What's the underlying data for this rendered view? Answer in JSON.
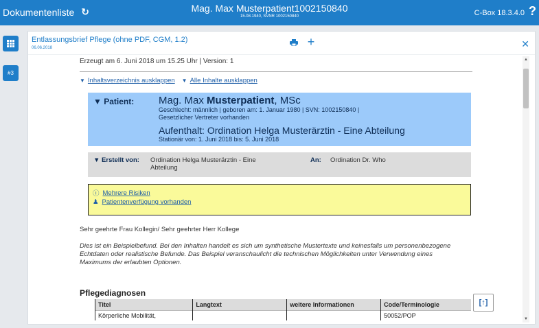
{
  "topbar": {
    "title": "Dokumentenliste",
    "refresh_icon": "refresh-icon",
    "patient_name": "Mag. Max Musterpatient1002150840",
    "patient_sub": "15.08.1940, SVNR 1002150840",
    "version": "C-Box 18.3.4.0",
    "help": "?"
  },
  "sidebar": {
    "grid_icon": "grid-icon",
    "badge": "#3"
  },
  "document": {
    "title": "Entlassungsbrief Pflege (ohne PDF, CGM, 1.2)",
    "date": "06.06.2018",
    "meta": "Erzeugt am 6. Juni 2018 um 15.25 Uhr | Version: 1",
    "toggle_toc": "Inhaltsverzeichnis ausklappen",
    "toggle_all": "Alle Inhalte ausklappen"
  },
  "patient": {
    "label": "Patient:",
    "name_prefix": "Mag. Max ",
    "name_bold": "Musterpatient",
    "name_suffix": ", MSc",
    "line1": "Geschlecht: männlich | geboren am: 1. Januar 1980 | SVN: 1002150840 |",
    "line2": "Gesetzlicher Vertreter vorhanden",
    "stay": "Aufenthalt:  Ordination Helga Musterärztin - Eine Abteilung",
    "stay_dates": "Stationär von: 1. Juni 2018 bis: 5. Juni 2018"
  },
  "creator": {
    "label": "Erstellt von:",
    "text": "Ordination Helga Musterärztin - Eine Abteilung",
    "an_label": "An:",
    "an_text": "Ordination Dr. Who"
  },
  "warnings": {
    "risk": "Mehrere Risiken",
    "directive": "Patientenverfügung vorhanden"
  },
  "body": {
    "greeting": "Sehr geehrte Frau Kollegin/ Sehr geehrter Herr Kollege",
    "intro": "Dies ist ein Beispielbefund. Bei den Inhalten handelt es sich um synthetische Mustertexte und keinesfalls um personenbezogene Echtdaten oder realistische Befunde. Das Beispiel veranschaulicht die technischen Möglichkeiten unter Verwendung eines Maximums der erlaubten Optionen."
  },
  "section": {
    "title": "Pflegediagnosen",
    "columns": [
      "Titel",
      "Langtext",
      "weitere Informationen",
      "Code/Terminologie"
    ],
    "rows": [
      [
        "Körperliche Mobilität,",
        "",
        "",
        "50052/POP"
      ]
    ]
  },
  "toc_button": "[↑]"
}
